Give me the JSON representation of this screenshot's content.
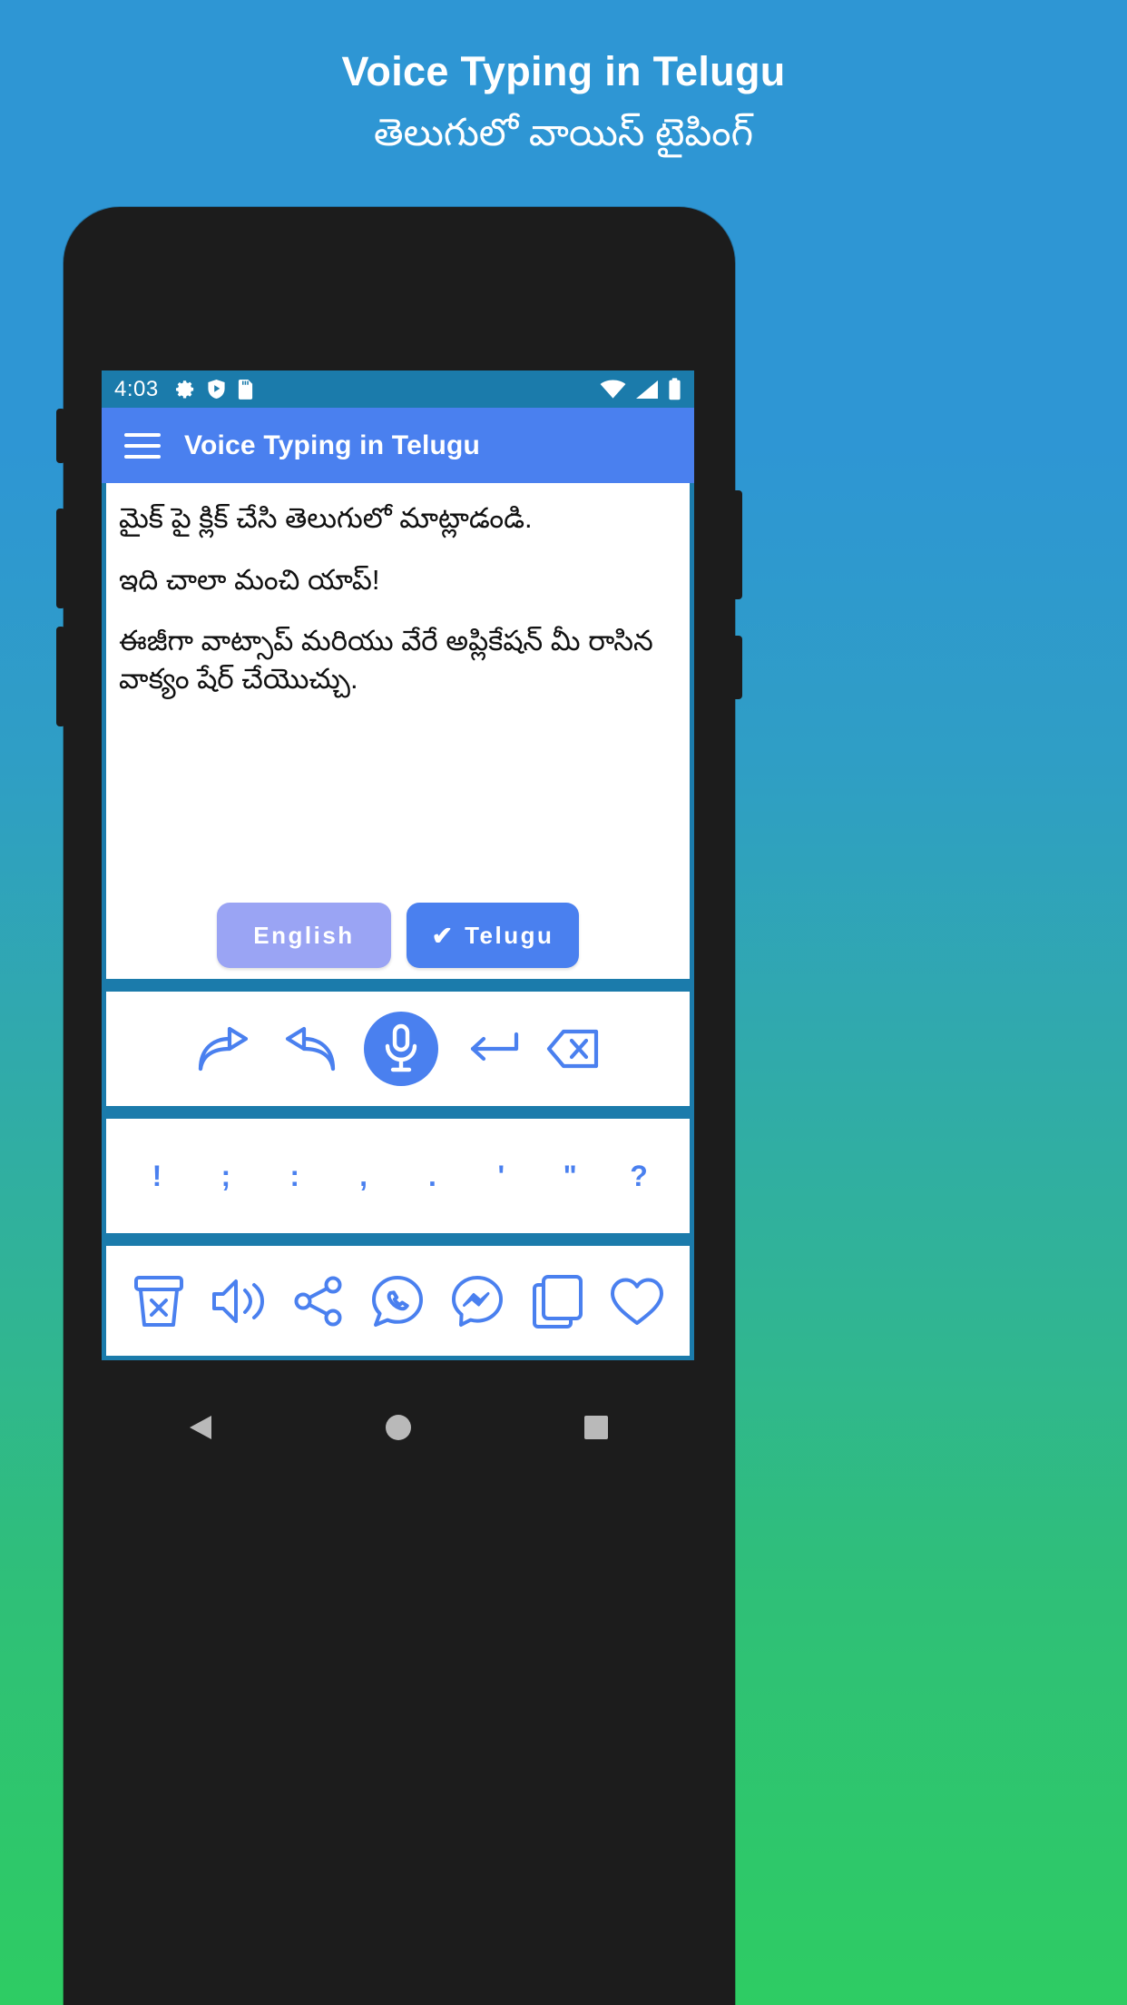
{
  "promo": {
    "title_en": "Voice Typing in Telugu",
    "title_te": "తెలుగులో వాయిస్ టైపింగ్"
  },
  "colors": {
    "bg_top": "#2e96d4",
    "bg_bottom": "#2ecc63",
    "status_bar": "#1b7bab",
    "app_bar": "#4a80ef",
    "accent_blue": "#4a80ef",
    "accent_lavender": "#9aa4f4",
    "separator": "#1b7bab",
    "text_body": "#111111",
    "phone_frame": "#1c1c1c"
  },
  "status_bar": {
    "clock": "4:03",
    "left_icons": [
      "gear-icon",
      "shield-play-icon",
      "sd-card-icon"
    ],
    "right_icons": [
      "wifi-icon",
      "signal-icon",
      "battery-icon"
    ]
  },
  "app_bar": {
    "menu_icon": "hamburger-menu-icon",
    "title": "Voice Typing in Telugu"
  },
  "editor": {
    "paragraphs": [
      "మైక్ పై క్లిక్ చేసి తెలుగులో మాట్లాడండి.",
      "ఇది చాలా మంచి యాప్!",
      "ఈజీగా వాట్సాప్ మరియు వేరే అప్లికేషన్ మీ రాసిన వాక్యం షేర్ చేయొచ్చు."
    ]
  },
  "language_buttons": [
    {
      "name": "english-button",
      "label": "English",
      "selected": false,
      "check": ""
    },
    {
      "name": "telugu-button",
      "label": "Telugu",
      "selected": true,
      "check": "✔"
    }
  ],
  "mic_toolbar": {
    "items": [
      {
        "name": "redo-button",
        "icon": "redo-arrow-icon"
      },
      {
        "name": "undo-button",
        "icon": "undo-arrow-icon"
      },
      {
        "name": "mic-button",
        "icon": "microphone-icon"
      },
      {
        "name": "newline-button",
        "icon": "enter-arrow-icon"
      },
      {
        "name": "backspace-button",
        "icon": "backspace-icon"
      }
    ]
  },
  "punctuation_row": {
    "keys": [
      "!",
      ";",
      ":",
      ",",
      ".",
      "'",
      "\"",
      "?"
    ]
  },
  "action_row": {
    "items": [
      {
        "name": "clear-text-button",
        "icon": "trash-x-icon"
      },
      {
        "name": "speak-button",
        "icon": "speaker-icon"
      },
      {
        "name": "share-button",
        "icon": "share-nodes-icon"
      },
      {
        "name": "whatsapp-button",
        "icon": "whatsapp-icon"
      },
      {
        "name": "messenger-button",
        "icon": "messenger-icon"
      },
      {
        "name": "copy-button",
        "icon": "copy-icon"
      },
      {
        "name": "favorite-button",
        "icon": "heart-icon"
      }
    ]
  },
  "nav_bar": {
    "items": [
      {
        "name": "android-back-button",
        "icon": "triangle-back-icon"
      },
      {
        "name": "android-home-button",
        "icon": "circle-home-icon"
      },
      {
        "name": "android-recents-button",
        "icon": "square-recents-icon"
      }
    ]
  }
}
